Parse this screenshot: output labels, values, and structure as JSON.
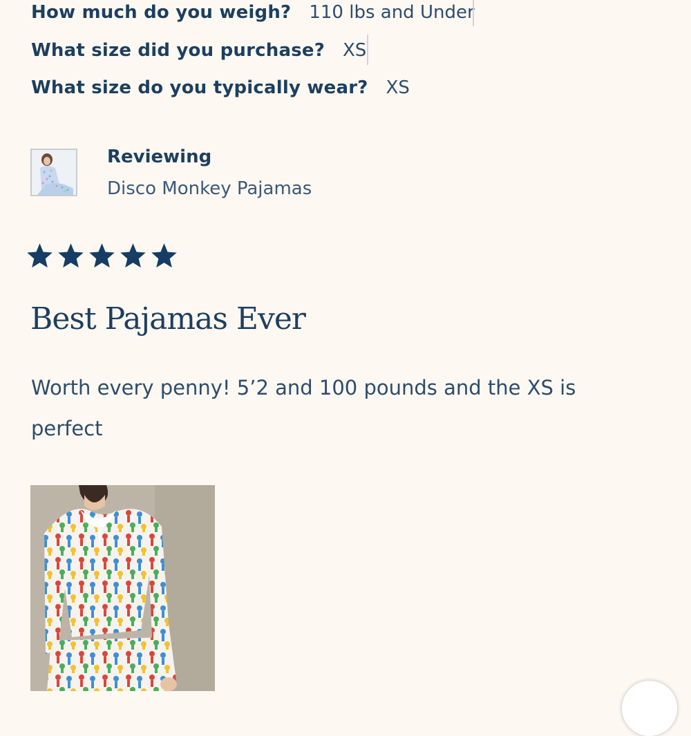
{
  "questions": [
    {
      "question": "How much do you weigh?",
      "answer": "110 lbs and Under"
    },
    {
      "question": "What size did you purchase?",
      "answer": "XS"
    },
    {
      "question": "What size do you typically wear?",
      "answer": "XS"
    }
  ],
  "reviewing": {
    "label": "Reviewing",
    "product": "Disco Monkey Pajamas"
  },
  "rating": {
    "value": 5,
    "max": 5,
    "icon": "star-icon",
    "color": "#163d63"
  },
  "review": {
    "title": "Best Pajamas Ever",
    "body": "Worth every penny! 5’2 and 100 pounds and the XS is perfect"
  },
  "colors": {
    "background": "#fdf8f2",
    "text": "#1d3f5f",
    "muted_text": "#3a5a78"
  }
}
